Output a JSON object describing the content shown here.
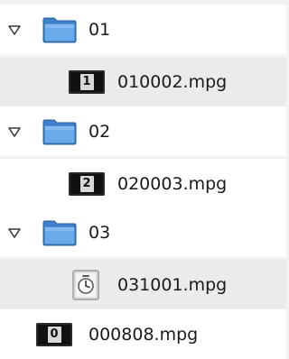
{
  "tree": {
    "folders": [
      {
        "label": "01",
        "expanded": true
      },
      {
        "label": "02",
        "expanded": true
      },
      {
        "label": "03",
        "expanded": true
      }
    ],
    "files": [
      {
        "label": "010002.mpg",
        "badge": "1",
        "icon": "video-file-icon"
      },
      {
        "label": "020003.mpg",
        "badge": "2",
        "icon": "video-file-icon"
      },
      {
        "label": "031001.mpg",
        "badge": "",
        "icon": "clock-file-icon"
      },
      {
        "label": "000808.mpg",
        "badge": "0",
        "icon": "video-file-icon"
      }
    ]
  },
  "colors": {
    "folder_blue": "#5a9be0",
    "row_alt": "#ebebeb",
    "row_plain": "#ffffff"
  }
}
